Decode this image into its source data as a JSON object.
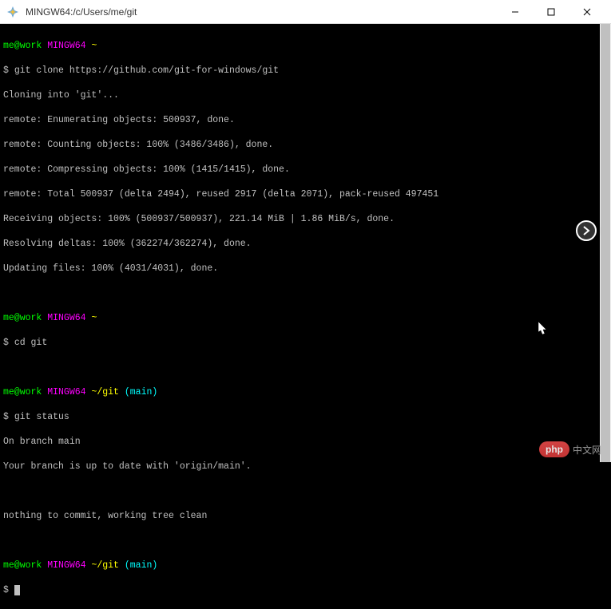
{
  "titlebar": {
    "title": "MINGW64:/c/Users/me/git"
  },
  "terminal": {
    "prompt1_user": "me@work",
    "prompt1_env": "MINGW64",
    "prompt1_path": "~",
    "cmd1": "git clone https://github.com/git-for-windows/git",
    "out1": "Cloning into 'git'...",
    "out2": "remote: Enumerating objects: 500937, done.",
    "out3": "remote: Counting objects: 100% (3486/3486), done.",
    "out4": "remote: Compressing objects: 100% (1415/1415), done.",
    "out5": "remote: Total 500937 (delta 2494), reused 2917 (delta 2071), pack-reused 497451",
    "out6": "Receiving objects: 100% (500937/500937), 221.14 MiB | 1.86 MiB/s, done.",
    "out7": "Resolving deltas: 100% (362274/362274), done.",
    "out8": "Updating files: 100% (4031/4031), done.",
    "prompt2_user": "me@work",
    "prompt2_env": "MINGW64",
    "prompt2_path": "~",
    "cmd2": "cd git",
    "prompt3_user": "me@work",
    "prompt3_env": "MINGW64",
    "prompt3_path": "~/git",
    "prompt3_branch": "(main)",
    "cmd3": "git status",
    "out9": "On branch main",
    "out10": "Your branch is up to date with 'origin/main'.",
    "out11": "nothing to commit, working tree clean",
    "prompt4_user": "me@work",
    "prompt4_env": "MINGW64",
    "prompt4_path": "~/git",
    "prompt4_branch": "(main)",
    "dollar": "$ ",
    "dollar_only": "$"
  },
  "watermark": {
    "pill": "php",
    "text": "中文网"
  }
}
